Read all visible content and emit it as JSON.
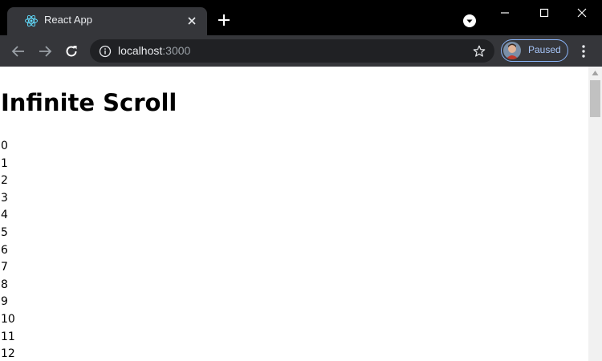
{
  "browser": {
    "tab": {
      "title": "React App",
      "favicon": "react-logo-icon"
    },
    "address": {
      "host": "localhost",
      "port": ":3000"
    },
    "profile": {
      "label": "Paused"
    }
  },
  "page": {
    "heading": "Infinite Scroll",
    "items": [
      "0",
      "1",
      "2",
      "3",
      "4",
      "5",
      "6",
      "7",
      "8",
      "9",
      "10",
      "11",
      "12"
    ]
  },
  "colors": {
    "tabstrip": "#000000",
    "toolbar": "#35363a",
    "omnibox": "#202124",
    "profile_accent": "#8ab4f8"
  }
}
